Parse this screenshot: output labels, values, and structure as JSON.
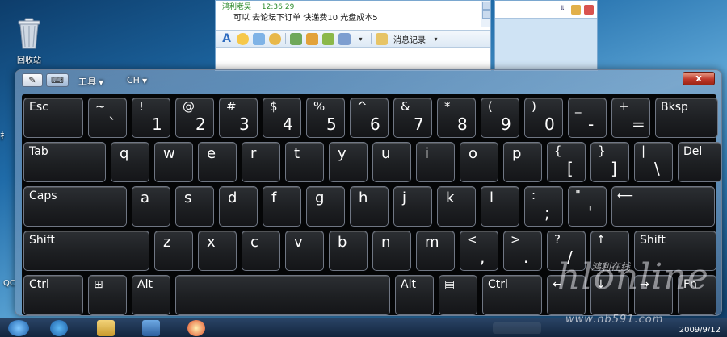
{
  "desktop": {
    "recycle_bin_label": "回收站",
    "edge_text_1": "扌",
    "edge_text_2": "QC"
  },
  "chat": {
    "sender": "鸿利老吴",
    "time": "12:36:29",
    "message": "可以 去论坛下订单  快递费10 光盘成本5",
    "history_label": "消息记录"
  },
  "osk": {
    "menu_tools": "工具",
    "menu_lang": "CH",
    "close_glyph": "x",
    "rows": [
      [
        {
          "id": "esc",
          "label": "Esc"
        },
        {
          "id": "tilde",
          "top": "~",
          "bottom": "`"
        },
        {
          "id": "1",
          "top": "!",
          "bottom": "1"
        },
        {
          "id": "2",
          "top": "@",
          "bottom": "2"
        },
        {
          "id": "3",
          "top": "#",
          "bottom": "3"
        },
        {
          "id": "4",
          "top": "$",
          "bottom": "4"
        },
        {
          "id": "5",
          "top": "%",
          "bottom": "5"
        },
        {
          "id": "6",
          "top": "^",
          "bottom": "6"
        },
        {
          "id": "7",
          "top": "&",
          "bottom": "7"
        },
        {
          "id": "8",
          "top": "*",
          "bottom": "8"
        },
        {
          "id": "9",
          "top": "(",
          "bottom": "9"
        },
        {
          "id": "0",
          "top": ")",
          "bottom": "0"
        },
        {
          "id": "minus",
          "top": "_",
          "bottom": "-"
        },
        {
          "id": "equals",
          "top": "+",
          "bottom": "="
        },
        {
          "id": "bksp",
          "label": "Bksp"
        }
      ],
      [
        {
          "id": "tab",
          "label": "Tab"
        },
        {
          "id": "q",
          "letter": "q"
        },
        {
          "id": "w",
          "letter": "w"
        },
        {
          "id": "e",
          "letter": "e"
        },
        {
          "id": "r",
          "letter": "r"
        },
        {
          "id": "t",
          "letter": "t"
        },
        {
          "id": "y",
          "letter": "y"
        },
        {
          "id": "u",
          "letter": "u"
        },
        {
          "id": "i",
          "letter": "i"
        },
        {
          "id": "o",
          "letter": "o"
        },
        {
          "id": "p",
          "letter": "p"
        },
        {
          "id": "lbracket",
          "top": "{",
          "bottom": "["
        },
        {
          "id": "rbracket",
          "top": "}",
          "bottom": "]"
        },
        {
          "id": "backslash",
          "top": "|",
          "bottom": "\\"
        },
        {
          "id": "del",
          "label": "Del"
        }
      ],
      [
        {
          "id": "caps",
          "label": "Caps"
        },
        {
          "id": "a",
          "letter": "a"
        },
        {
          "id": "s",
          "letter": "s"
        },
        {
          "id": "d",
          "letter": "d"
        },
        {
          "id": "f",
          "letter": "f"
        },
        {
          "id": "g",
          "letter": "g"
        },
        {
          "id": "h",
          "letter": "h"
        },
        {
          "id": "j",
          "letter": "j"
        },
        {
          "id": "k",
          "letter": "k"
        },
        {
          "id": "l",
          "letter": "l"
        },
        {
          "id": "semicolon",
          "top": ":",
          "bottom": ";"
        },
        {
          "id": "quote",
          "top": "\"",
          "bottom": "'"
        },
        {
          "id": "enter",
          "label": "⟵"
        }
      ],
      [
        {
          "id": "lshift",
          "label": "Shift"
        },
        {
          "id": "z",
          "letter": "z"
        },
        {
          "id": "x",
          "letter": "x"
        },
        {
          "id": "c",
          "letter": "c"
        },
        {
          "id": "v",
          "letter": "v"
        },
        {
          "id": "b",
          "letter": "b"
        },
        {
          "id": "n",
          "letter": "n"
        },
        {
          "id": "m",
          "letter": "m"
        },
        {
          "id": "comma",
          "top": "<",
          "bottom": ","
        },
        {
          "id": "period",
          "top": ">",
          "bottom": "."
        },
        {
          "id": "slash",
          "top": "?",
          "bottom": "/"
        },
        {
          "id": "up",
          "label": "↑"
        },
        {
          "id": "rshift",
          "label": "Shift"
        }
      ],
      [
        {
          "id": "lctrl",
          "label": "Ctrl"
        },
        {
          "id": "win",
          "label": "⊞"
        },
        {
          "id": "lalt",
          "label": "Alt"
        },
        {
          "id": "space",
          "label": ""
        },
        {
          "id": "ralt",
          "label": "Alt"
        },
        {
          "id": "menu",
          "label": "▤"
        },
        {
          "id": "rctrl",
          "label": "Ctrl"
        },
        {
          "id": "left",
          "label": "←"
        },
        {
          "id": "down",
          "label": "↓"
        },
        {
          "id": "right",
          "label": "→"
        },
        {
          "id": "fn",
          "label": "Fn"
        }
      ]
    ]
  },
  "watermark": {
    "logo": "hlonline",
    "cn": "鸿利在线",
    "url": "www.nb591.com"
  },
  "taskbar": {
    "clock": "2009/9/12"
  }
}
